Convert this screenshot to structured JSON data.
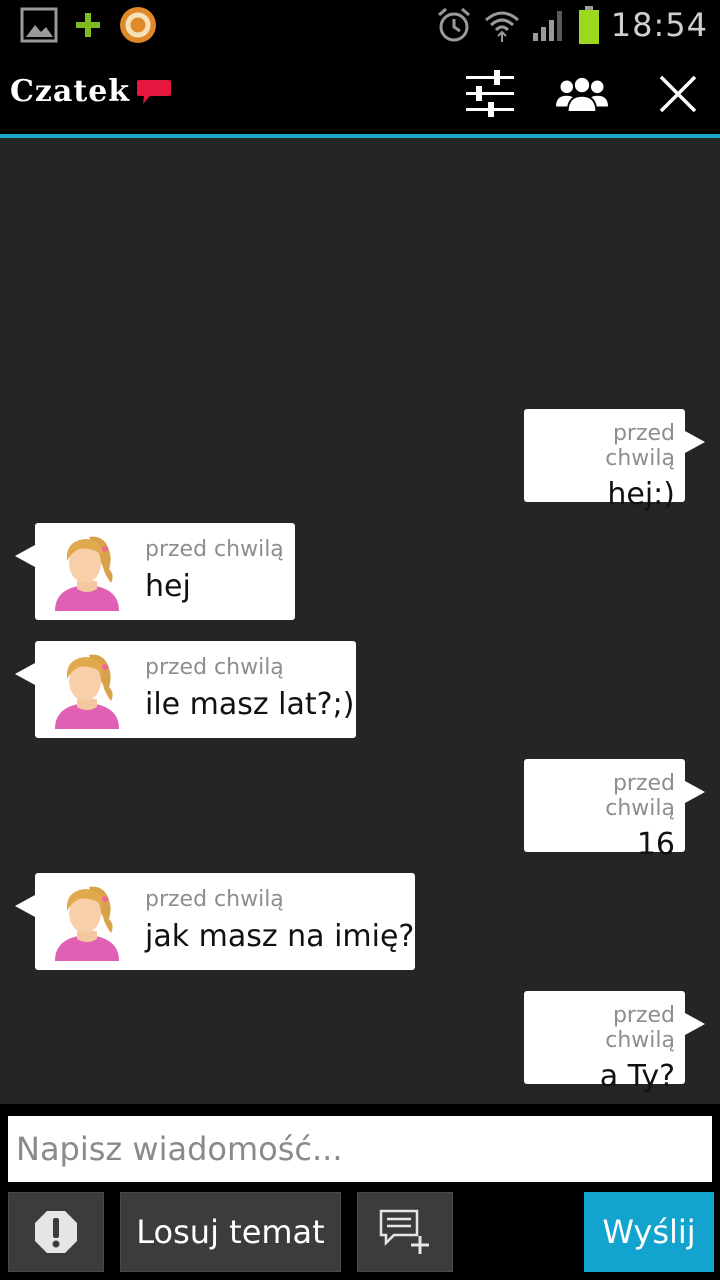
{
  "status_bar": {
    "time": "18:54",
    "icons": [
      "gallery-icon",
      "plus-icon",
      "app-icon",
      "alarm-icon",
      "wifi-icon",
      "signal-icon",
      "battery-icon"
    ]
  },
  "app_bar": {
    "logo_text": "Czatek",
    "actions": [
      "settings-sliders-icon",
      "users-icon",
      "close-icon"
    ]
  },
  "messages": [
    {
      "direction": "out",
      "time": "przed chwilą",
      "text": "hej:)"
    },
    {
      "direction": "in",
      "time": "przed chwilą",
      "text": "hej"
    },
    {
      "direction": "in",
      "time": "przed chwilą",
      "text": "ile masz lat?;)"
    },
    {
      "direction": "out",
      "time": "przed chwilą",
      "text": "16"
    },
    {
      "direction": "in",
      "time": "przed chwilą",
      "text": "jak masz na imię?"
    },
    {
      "direction": "out",
      "time": "przed chwilą",
      "text": "a Ty?"
    }
  ],
  "composer": {
    "placeholder": "Napisz wiadomość...",
    "report_icon": "alert-octagon-icon",
    "random_topic_label": "Losuj temat",
    "new_topic_icon": "add-topic-icon",
    "send_label": "Wyślij"
  },
  "colors": {
    "accent": "#1ba6c9",
    "send_button": "#12a4cf",
    "background": "#252525",
    "logo_bubble": "#e5173f"
  }
}
